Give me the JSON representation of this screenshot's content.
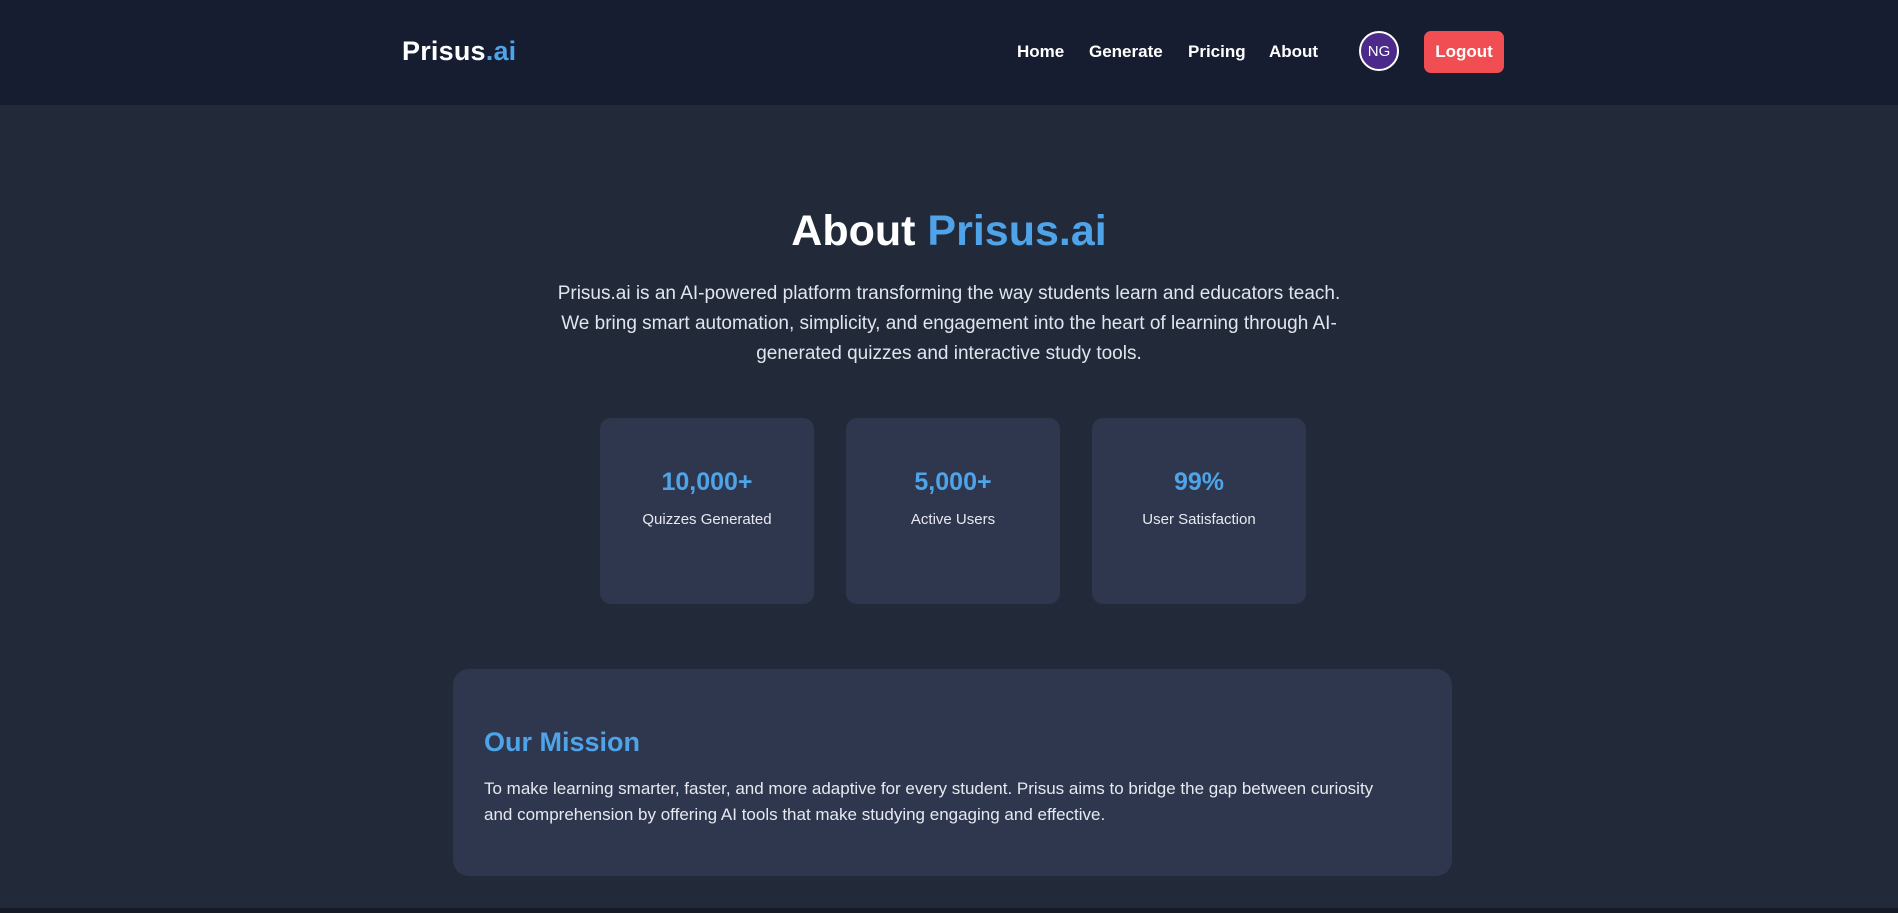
{
  "header": {
    "logo_main": "Prisus",
    "logo_accent": ".ai",
    "nav": [
      "Home",
      "Generate",
      "Pricing",
      "About"
    ],
    "avatar_initials": "NG",
    "logout_label": "Logout"
  },
  "hero": {
    "title_main": "About",
    "title_accent": "Prisus.ai",
    "description": "Prisus.ai is an AI-powered platform transforming the way students learn and educators teach. We bring smart automation, simplicity, and engagement into the heart of learning through AI-generated quizzes and interactive study tools."
  },
  "stats": [
    {
      "value": "10,000+",
      "label": "Quizzes Generated"
    },
    {
      "value": "5,000+",
      "label": "Active Users"
    },
    {
      "value": "99%",
      "label": "User Satisfaction"
    }
  ],
  "mission": {
    "title": "Our Mission",
    "text": "To make learning smarter, faster, and more adaptive for every student. Prisus aims to bridge the gap between curiosity and comprehension by offering AI tools that make studying engaging and effective."
  },
  "colors": {
    "accent": "#4fa3e8",
    "navbar_bg": "#161d30",
    "page_bg": "#222a3a",
    "card_bg": "#2e374d",
    "logout_bg": "#f04e52",
    "avatar_bg": "#4b2a8a"
  }
}
